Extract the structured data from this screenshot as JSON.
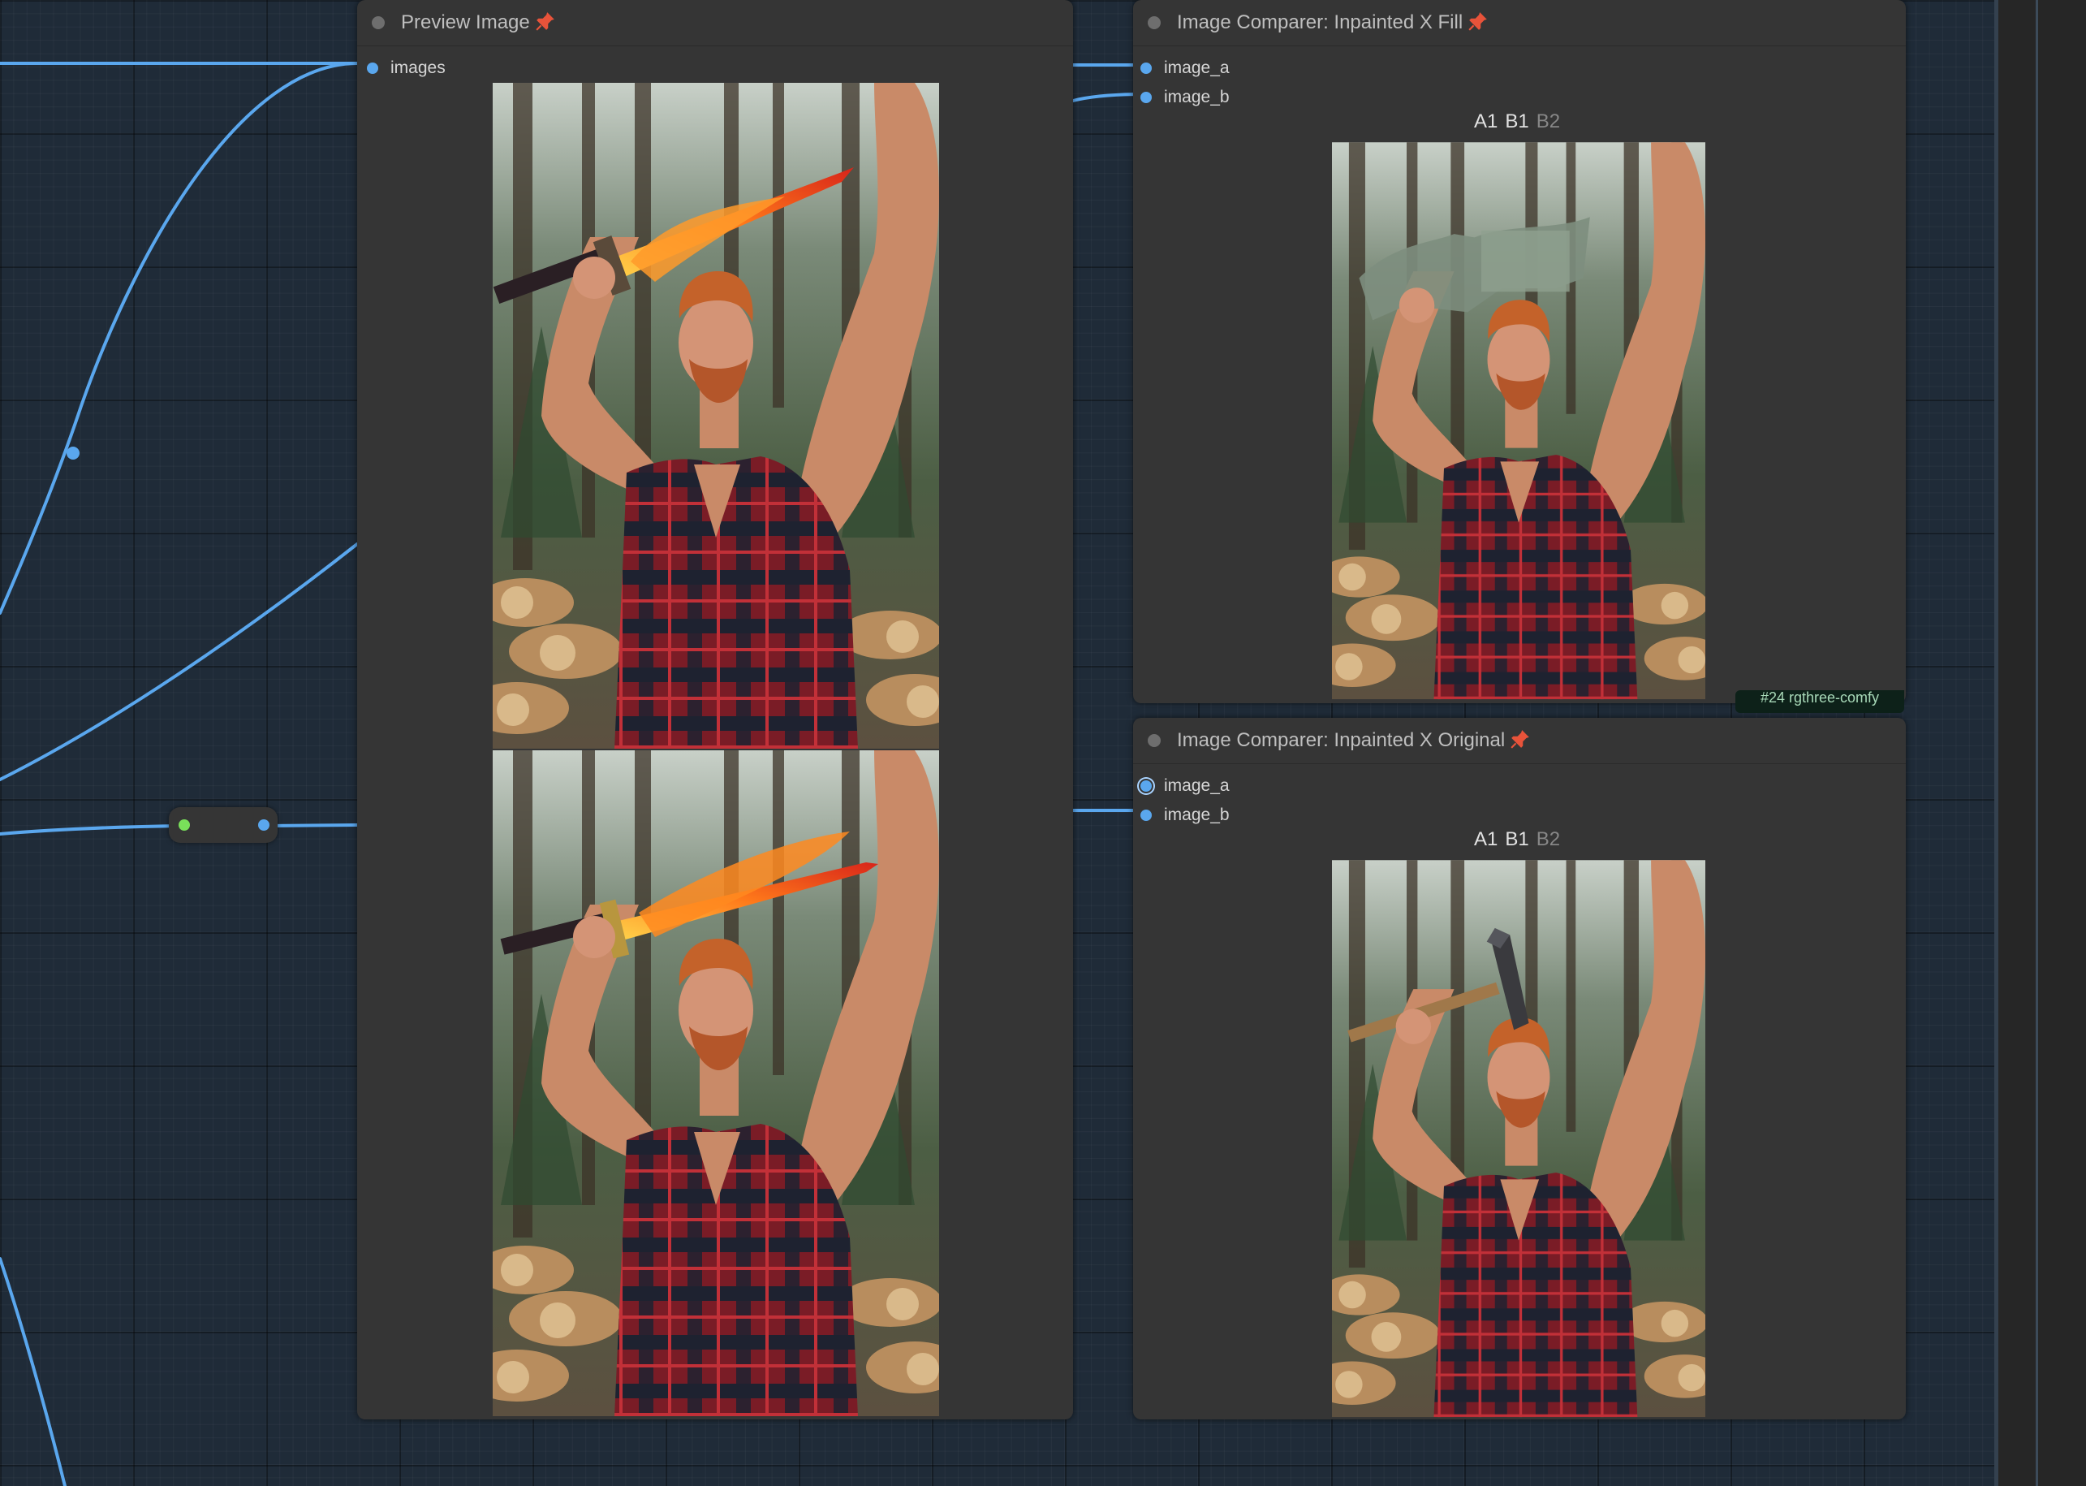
{
  "colors": {
    "canvas_bg": "#1f2b38",
    "node_bg": "#353535",
    "wire_blue": "#5aa7ee",
    "wire_green": "#79e05a",
    "pin_red": "#e8533a"
  },
  "preview_node": {
    "title": "Preview Image",
    "pin_icon": "pin-icon",
    "inputs": [
      {
        "label": "images"
      }
    ]
  },
  "comparer_fill": {
    "title": "Image Comparer: Inpainted X Fill",
    "pin_icon": "pin-icon",
    "inputs": [
      {
        "label": "image_a"
      },
      {
        "label": "image_b"
      }
    ],
    "labels": {
      "a1": "A1",
      "b1": "B1",
      "b2": "B2"
    }
  },
  "comparer_original": {
    "title": "Image Comparer: Inpainted X Original",
    "pin_icon": "pin-icon",
    "inputs": [
      {
        "label": "image_a"
      },
      {
        "label": "image_b"
      }
    ],
    "labels": {
      "a1": "A1",
      "b1": "B1",
      "b2": "B2"
    }
  },
  "footer_tag": {
    "text": "#24 rgthree-comfy"
  }
}
